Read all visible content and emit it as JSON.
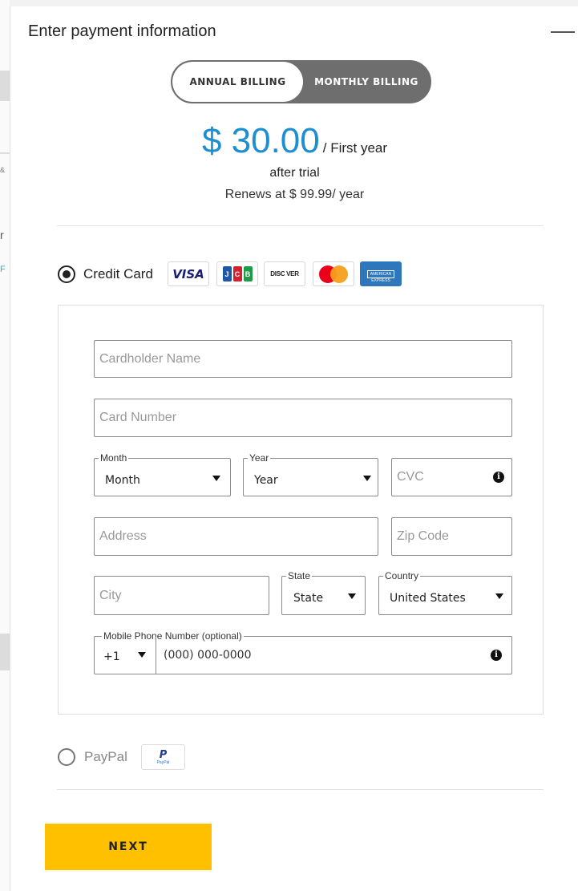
{
  "background": {
    "fragments": [
      "&",
      "r",
      "F"
    ]
  },
  "header": {
    "title": "Enter payment information"
  },
  "billing": {
    "annual_label": "ANNUAL BILLING",
    "monthly_label": "MONTHLY BILLING",
    "selected": "annual"
  },
  "price": {
    "amount": "$ 30.00",
    "period": "/ First year",
    "trial": "after trial",
    "renewal": "Renews at $ 99.99/ year"
  },
  "payment_methods": {
    "credit_card": {
      "label": "Credit Card",
      "selected": true,
      "logos": {
        "visa": "VISA",
        "jcb": [
          "J",
          "C",
          "B"
        ],
        "discover": "DISC VER",
        "amex": "AMERICAN EXPRESS"
      }
    },
    "paypal": {
      "label": "PayPal",
      "selected": false,
      "logo_mark": "P",
      "logo_word": "PayPal"
    }
  },
  "form": {
    "cardholder_name": {
      "placeholder": "Cardholder Name",
      "value": ""
    },
    "card_number": {
      "placeholder": "Card Number",
      "value": ""
    },
    "month": {
      "label": "Month",
      "value": "Month"
    },
    "year": {
      "label": "Year",
      "value": "Year"
    },
    "cvc": {
      "placeholder": "CVC",
      "value": ""
    },
    "address": {
      "placeholder": "Address",
      "value": ""
    },
    "zip": {
      "placeholder": "Zip Code",
      "value": ""
    },
    "city": {
      "placeholder": "City",
      "value": ""
    },
    "state": {
      "label": "State",
      "value": "State"
    },
    "country": {
      "label": "Country",
      "value": "United States"
    },
    "phone": {
      "label": "Mobile Phone Number (optional)",
      "country_code": "+1",
      "placeholder": "(000) 000-0000"
    },
    "info_glyph": "i"
  },
  "actions": {
    "next_label": "NEXT"
  },
  "colors": {
    "price": "#1d8fd1",
    "next_button": "#ffc000",
    "toggle_dark": "#6e6e6e"
  }
}
